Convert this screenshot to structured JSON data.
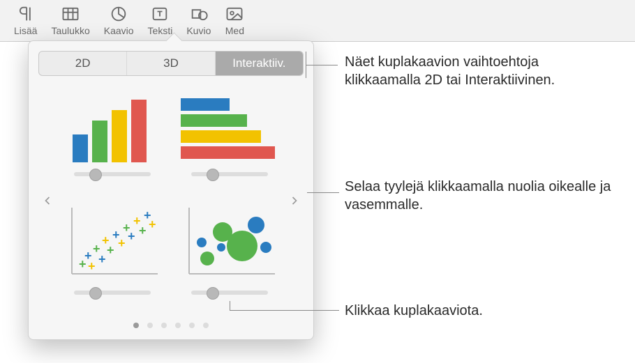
{
  "toolbar": {
    "insert": "Lisää",
    "table": "Taulukko",
    "chart": "Kaavio",
    "text": "Teksti",
    "shape": "Kuvio",
    "media": "Med"
  },
  "segments": {
    "s0": "2D",
    "s1": "3D",
    "s2": "Interaktiiv."
  },
  "callouts": {
    "c1": "Näet kuplakaavion vaihtoehtoja klikkaamalla 2D tai Interaktiivinen.",
    "c2": "Selaa tyylejä klikkaamalla nuolia oikealle ja vasemmalle.",
    "c3": "Klikkaa kuplakaaviota."
  },
  "thumbs": {
    "t0": "column-chart",
    "t1": "bar-chart",
    "t2": "scatter-chart",
    "t3": "bubble-chart"
  }
}
